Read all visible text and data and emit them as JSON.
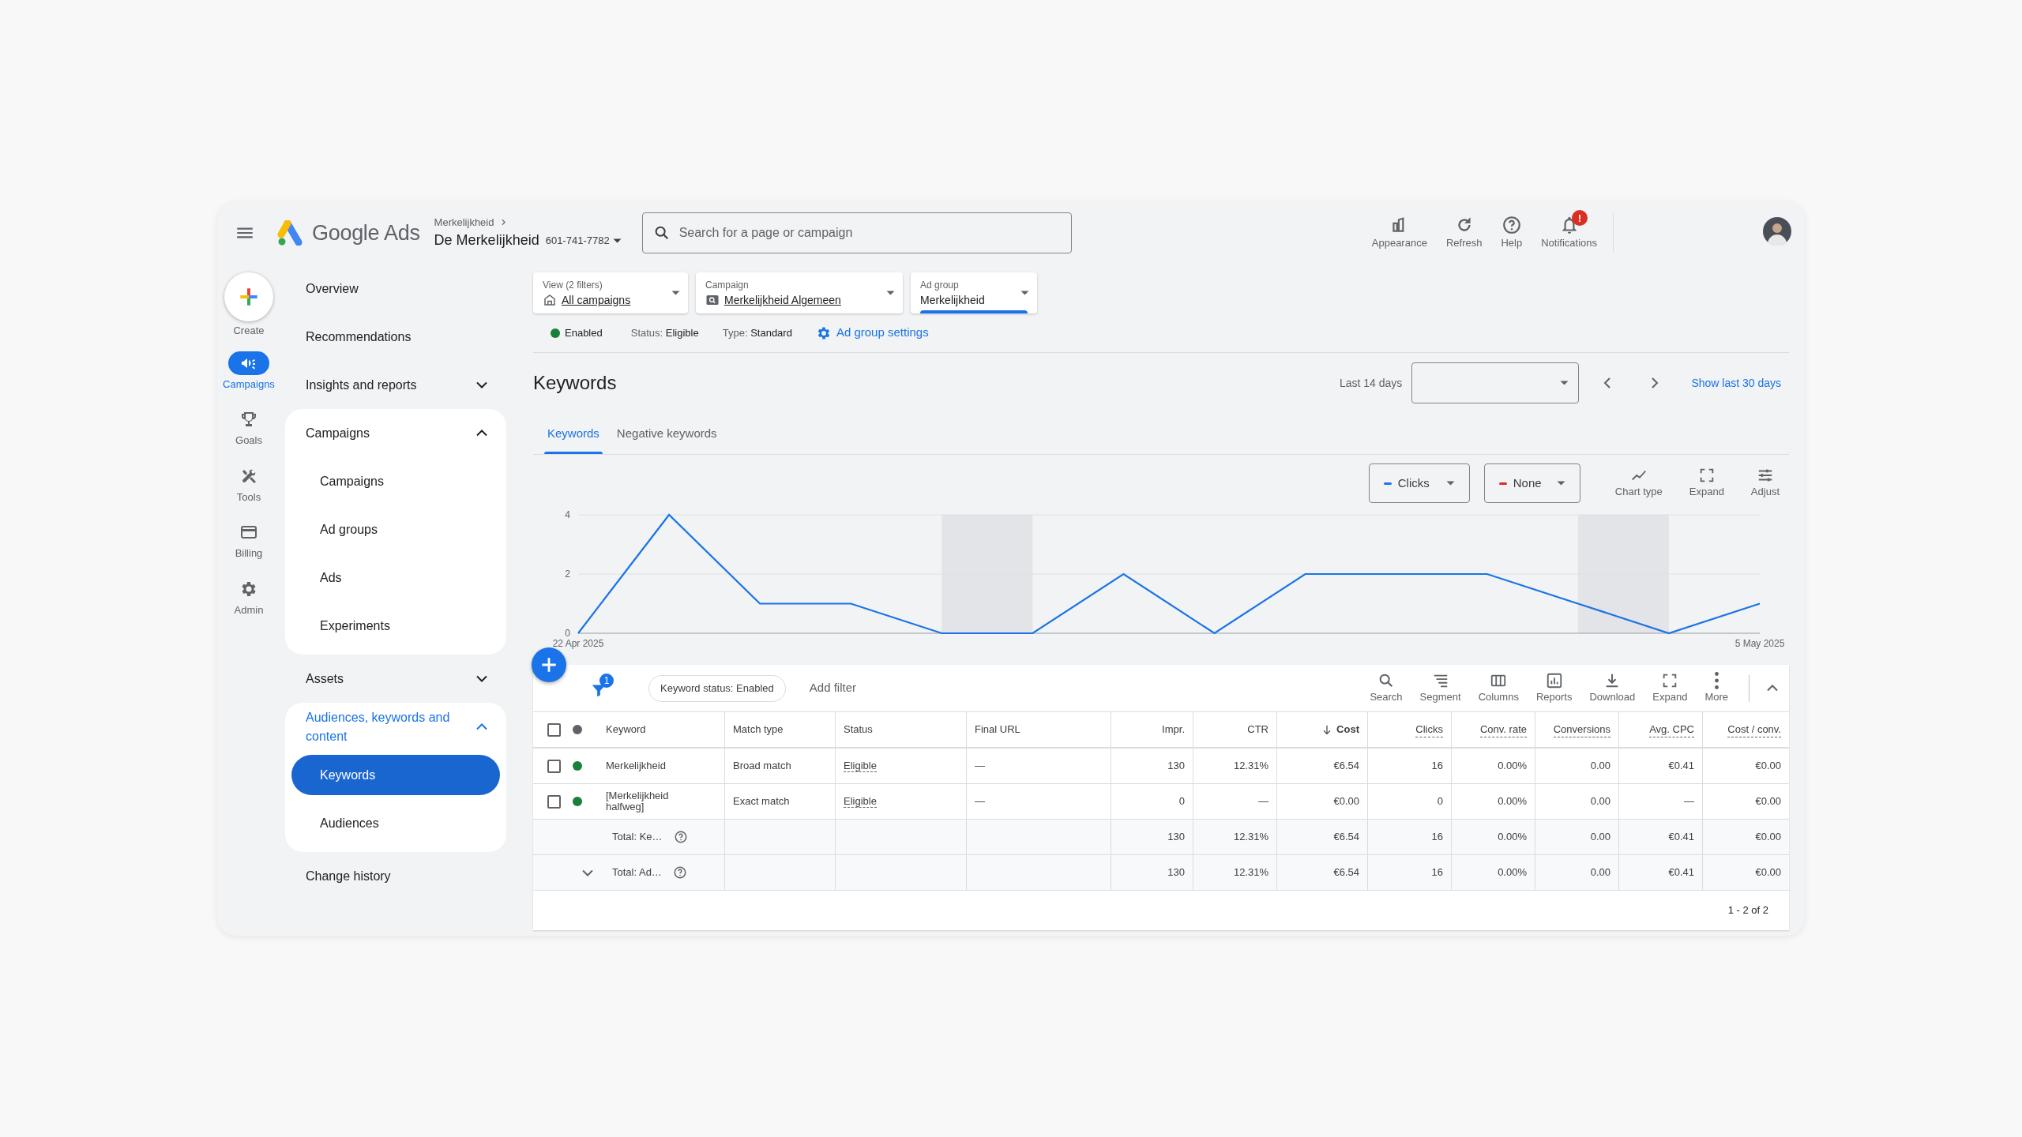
{
  "header": {
    "app_name": "Google Ads",
    "breadcrumb_parent": "Merkelijkheid",
    "account_name": "De Merkelijkheid",
    "account_id": "601-741-7782",
    "search": {
      "placeholder": "Search for a page or campaign"
    },
    "actions": [
      {
        "label": "Appearance"
      },
      {
        "label": "Refresh"
      },
      {
        "label": "Help"
      },
      {
        "label": "Notifications",
        "badge": "!"
      }
    ]
  },
  "rail": [
    {
      "label": "Create",
      "selected": false
    },
    {
      "label": "Campaigns",
      "selected": true
    },
    {
      "label": "Goals",
      "selected": false
    },
    {
      "label": "Tools",
      "selected": false
    },
    {
      "label": "Billing",
      "selected": false
    },
    {
      "label": "Admin",
      "selected": false
    }
  ],
  "nav": [
    {
      "label": "Overview",
      "selected": false
    },
    {
      "label": "Recommendations",
      "selected": false
    },
    {
      "label": "Insights and reports",
      "selected": false,
      "expanded": false
    },
    {
      "label": "Campaigns",
      "selected": false,
      "expanded": true,
      "children": [
        {
          "label": "Campaigns",
          "selected": false
        },
        {
          "label": "Ad groups",
          "selected": false
        },
        {
          "label": "Ads",
          "selected": false
        },
        {
          "label": "Experiments",
          "selected": false
        }
      ]
    },
    {
      "label": "Assets",
      "selected": false,
      "expanded": false
    },
    {
      "label": "Audiences, keywords and content",
      "selected": true,
      "expanded": true,
      "children": [
        {
          "label": "Keywords",
          "selected": true
        },
        {
          "label": "Audiences",
          "selected": false
        }
      ]
    },
    {
      "label": "Change history",
      "selected": false
    }
  ],
  "scope": [
    {
      "label": "View (2 filters)",
      "value": "All campaigns",
      "selected": false
    },
    {
      "label": "Campaign",
      "value": "Merkelijkheid Algemeen",
      "selected": false
    },
    {
      "label": "Ad group",
      "value": "Merkelijkheid",
      "selected": true
    }
  ],
  "ad_group_status": {
    "state": "Enabled",
    "color": "#188038",
    "status": "Status: **Eligible**",
    "type": "Type: **Standard**",
    "settings_link": "Ad group settings"
  },
  "page_title": "Keywords",
  "date_range": {
    "label": "Last 14 days",
    "show_more": "Show last 30 days"
  },
  "tabs": [
    {
      "label": "Keywords",
      "selected": true
    },
    {
      "label": "Negative keywords",
      "selected": false
    }
  ],
  "chart_controls": {
    "metrics": [
      {
        "label": "None",
        "color": "#d93025"
      }
    ],
    "tools": [
      {
        "label": "Chart type"
      },
      {
        "label": "Expand"
      },
      {
        "label": "Adjust"
      }
    ]
  },
  "chart_data": {
    "type": "line",
    "categories": [
      "22 Apr 2025",
      null,
      null,
      null,
      null,
      null,
      null,
      null,
      null,
      null,
      null,
      null,
      null,
      "5 May 2025"
    ],
    "ylim": [
      0,
      4
    ],
    "yticks": [
      0,
      2,
      4
    ],
    "series": [
      {
        "name": "Clicks",
        "color": "#1a73e8",
        "values": [
          0,
          4,
          1,
          1,
          0,
          0,
          2,
          0,
          2,
          2,
          2,
          1,
          0,
          1
        ]
      }
    ]
  },
  "table_toolbar": {
    "filter_count": "1",
    "filter_chip": "Keyword status: Enabled",
    "add_filter": "Add filter",
    "tools": [
      {
        "label": "Search"
      },
      {
        "label": "Segment"
      },
      {
        "label": "Columns"
      },
      {
        "label": "Reports"
      },
      {
        "label": "Download"
      },
      {
        "label": "Expand"
      },
      {
        "label": "More"
      }
    ]
  },
  "table": {
    "select_all": false,
    "columns": [
      {
        "label": "Keyword",
        "dashed": false,
        "sorted": false
      },
      {
        "label": "Match type",
        "dashed": false,
        "sorted": false
      },
      {
        "label": "Status",
        "dashed": false,
        "sorted": false
      },
      {
        "label": "Final URL",
        "dashed": false,
        "sorted": false
      },
      {
        "label": "Impr.",
        "dashed": false,
        "sorted": false
      },
      {
        "label": "CTR",
        "dashed": false,
        "sorted": false
      },
      {
        "label": "Cost",
        "dashed": false,
        "sorted": true
      },
      {
        "label": "Clicks",
        "dashed": true,
        "sorted": false
      },
      {
        "label": "Conv. rate",
        "dashed": true,
        "sorted": false
      },
      {
        "label": "Conversions",
        "dashed": true,
        "sorted": false
      },
      {
        "label": "Avg. CPC",
        "dashed": true,
        "sorted": false
      },
      {
        "label": "Cost / conv.",
        "dashed": true,
        "sorted": false
      }
    ],
    "rows": [
      {
        "selected": false,
        "color": "#188038",
        "cells": [
          "Merkelijkheid",
          "Broad match",
          "Eligible",
          "—",
          "130",
          "12.31%",
          "€6.54",
          "16",
          "0.00%",
          "0.00",
          "€0.41",
          "€0.00"
        ]
      },
      {
        "selected": false,
        "color": "#188038",
        "cells": [
          "[Merkelijkheid halfweg]",
          "Exact match",
          "Eligible",
          "—",
          "0",
          "—",
          "€0.00",
          "0",
          "0.00%",
          "0.00",
          "—",
          "€0.00"
        ]
      }
    ],
    "totals": [
      {
        "label": "Total: Ke…",
        "values": [
          "130",
          "12.31%",
          "€6.54",
          "16",
          "0.00%",
          "0.00",
          "€0.41",
          "€0.00"
        ]
      },
      {
        "label": "Total: Ad…",
        "expanded": false,
        "values": [
          "130",
          "12.31%",
          "€6.54",
          "16",
          "0.00%",
          "0.00",
          "€0.41",
          "€0.00"
        ]
      }
    ],
    "pagination": "1 - 2 of 2"
  }
}
